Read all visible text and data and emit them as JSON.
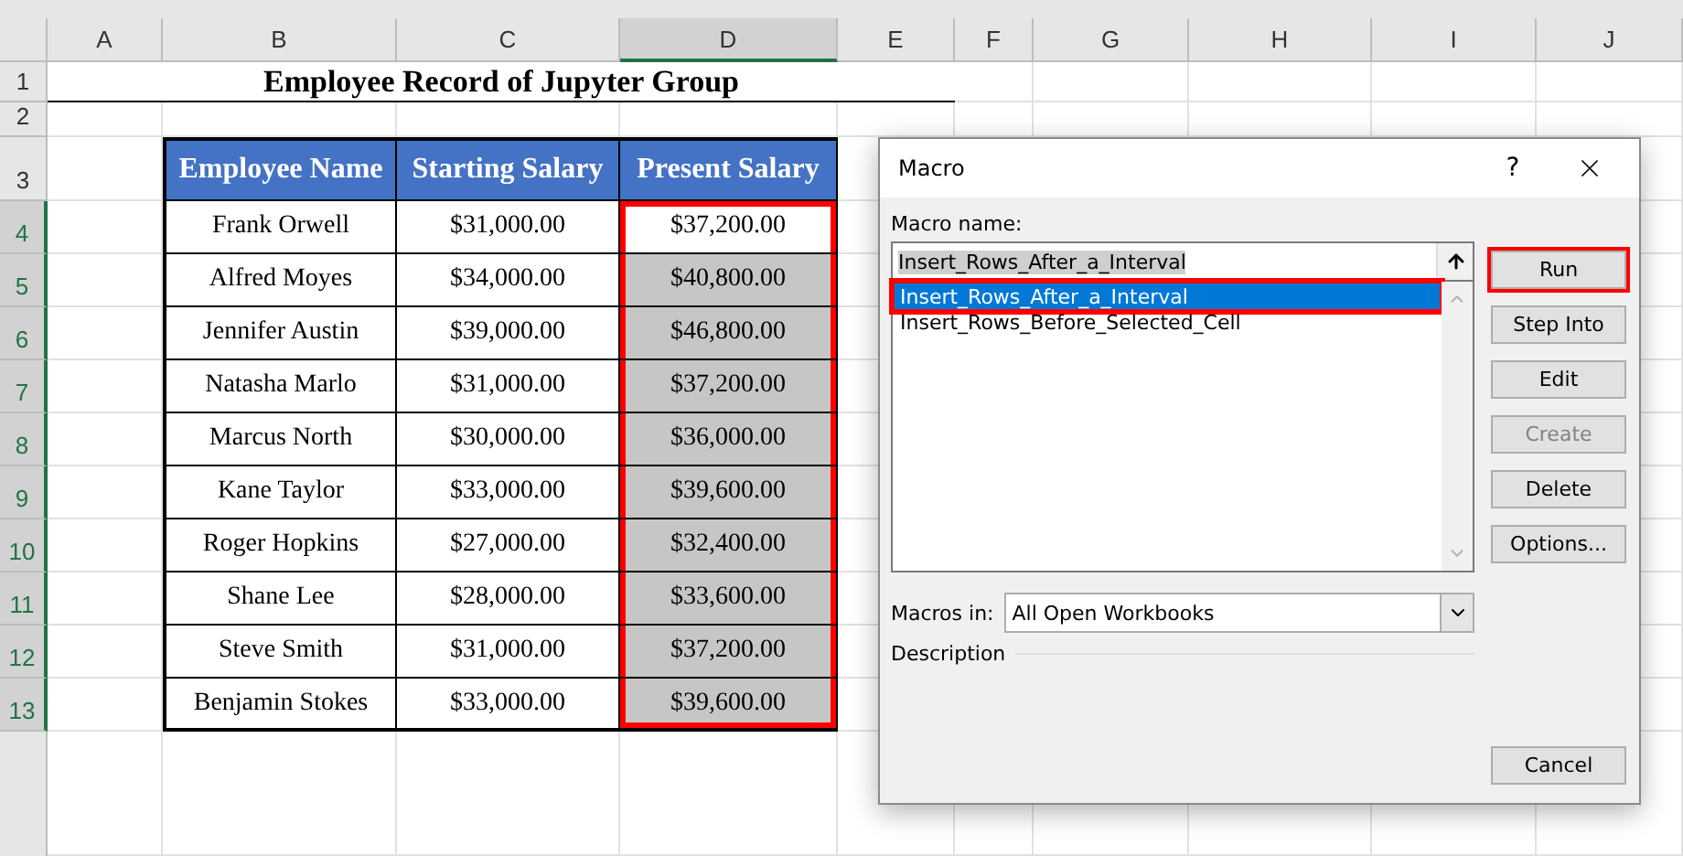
{
  "sheet": {
    "columns": [
      {
        "label": "A",
        "selected": false
      },
      {
        "label": "B",
        "selected": false
      },
      {
        "label": "C",
        "selected": false
      },
      {
        "label": "D",
        "selected": true
      },
      {
        "label": "E",
        "selected": false
      },
      {
        "label": "F",
        "selected": false
      },
      {
        "label": "G",
        "selected": false
      },
      {
        "label": "H",
        "selected": false
      },
      {
        "label": "I",
        "selected": false
      },
      {
        "label": "J",
        "selected": false
      }
    ],
    "rows": [
      {
        "label": "1",
        "selected": false
      },
      {
        "label": "2",
        "selected": false
      },
      {
        "label": "3",
        "selected": false
      },
      {
        "label": "4",
        "selected": true
      },
      {
        "label": "5",
        "selected": true
      },
      {
        "label": "6",
        "selected": true
      },
      {
        "label": "7",
        "selected": true
      },
      {
        "label": "8",
        "selected": true
      },
      {
        "label": "9",
        "selected": true
      },
      {
        "label": "10",
        "selected": true
      },
      {
        "label": "11",
        "selected": true
      },
      {
        "label": "12",
        "selected": true
      },
      {
        "label": "13",
        "selected": true
      }
    ],
    "title": "Employee Record of Jupyter Group",
    "table": {
      "columns": [
        {
          "label": "Employee Name",
          "highlighted": false
        },
        {
          "label": "Starting Salary",
          "highlighted": false
        },
        {
          "label": "Present Salary",
          "highlighted": true
        }
      ],
      "rows": [
        {
          "cells": [
            "Frank Orwell",
            "$31,000.00",
            "$37,200.00"
          ],
          "active": true
        },
        {
          "cells": [
            "Alfred Moyes",
            "$34,000.00",
            "$40,800.00"
          ],
          "active": false
        },
        {
          "cells": [
            "Jennifer Austin",
            "$39,000.00",
            "$46,800.00"
          ],
          "active": false
        },
        {
          "cells": [
            "Natasha Marlo",
            "$31,000.00",
            "$37,200.00"
          ],
          "active": false
        },
        {
          "cells": [
            "Marcus North",
            "$30,000.00",
            "$36,000.00"
          ],
          "active": false
        },
        {
          "cells": [
            "Kane Taylor",
            "$33,000.00",
            "$39,600.00"
          ],
          "active": false
        },
        {
          "cells": [
            "Roger Hopkins",
            "$27,000.00",
            "$32,400.00"
          ],
          "active": false
        },
        {
          "cells": [
            "Shane Lee",
            "$28,000.00",
            "$33,600.00"
          ],
          "active": false
        },
        {
          "cells": [
            "Steve Smith",
            "$31,000.00",
            "$37,200.00"
          ],
          "active": false
        },
        {
          "cells": [
            "Benjamin Stokes",
            "$33,000.00",
            "$39,600.00"
          ],
          "active": false
        }
      ]
    }
  },
  "dialog": {
    "title": "Macro",
    "help": "?",
    "macro_name_label": "Macro name:",
    "macro_name_value": "Insert_Rows_After_a_Interval",
    "macros": [
      {
        "label": "Insert_Rows_After_a_Interval",
        "selected": true,
        "highlighted": true
      },
      {
        "label": "Insert_Rows_Before_Selected_Cell",
        "selected": false,
        "highlighted": false
      }
    ],
    "buttons": [
      {
        "label": "Run",
        "disabled": false,
        "highlighted": true
      },
      {
        "label": "Step Into",
        "disabled": false,
        "highlighted": false
      },
      {
        "label": "Edit",
        "disabled": false,
        "highlighted": false
      },
      {
        "label": "Create",
        "disabled": true,
        "highlighted": false
      },
      {
        "label": "Delete",
        "disabled": false,
        "highlighted": false
      },
      {
        "label": "Options...",
        "disabled": false,
        "highlighted": false
      }
    ],
    "macros_in_label": "Macros in:",
    "macros_in_value": "All Open Workbooks",
    "description_label": "Description",
    "cancel": "Cancel"
  }
}
